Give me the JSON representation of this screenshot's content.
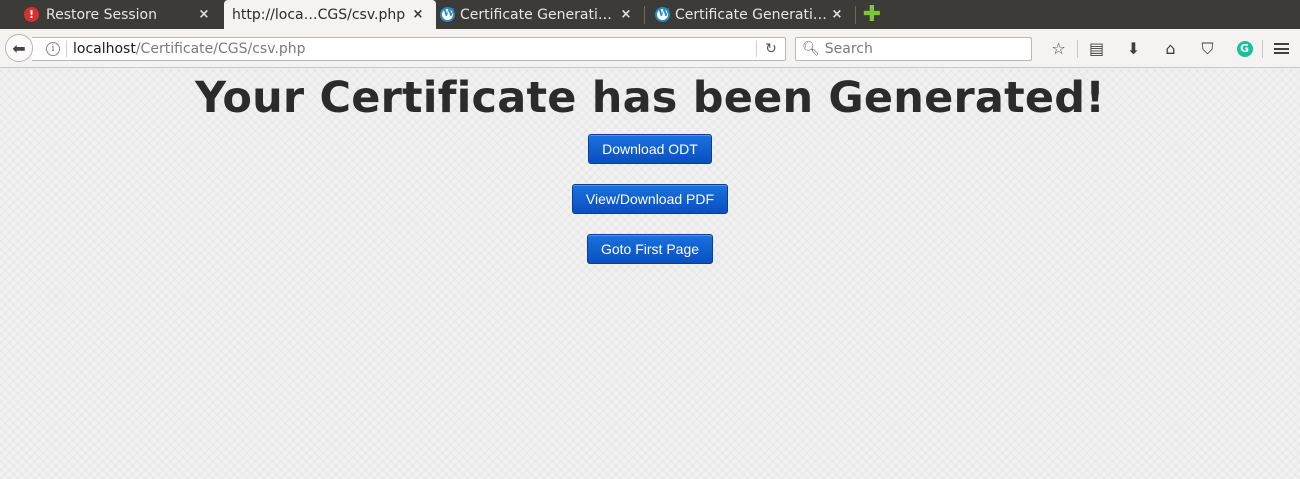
{
  "tabs": [
    {
      "label": "Restore Session"
    },
    {
      "label": "http://loca…CGS/csv.php"
    },
    {
      "label": "Certificate Generati…"
    },
    {
      "label": "Certificate Generati…"
    }
  ],
  "tab_close_glyph": "×",
  "url": {
    "host": "localhost",
    "path": "/Certificate/CGS/csv.php"
  },
  "search": {
    "placeholder": "Search"
  },
  "page": {
    "title": "Your Certificate has been Generated!",
    "buttons": [
      "Download ODT",
      "View/Download PDF",
      "Goto First Page"
    ]
  },
  "colors": {
    "button": "#0a5fd0",
    "tabstrip": "#3c3b37",
    "grammarly": "#15c39a"
  }
}
